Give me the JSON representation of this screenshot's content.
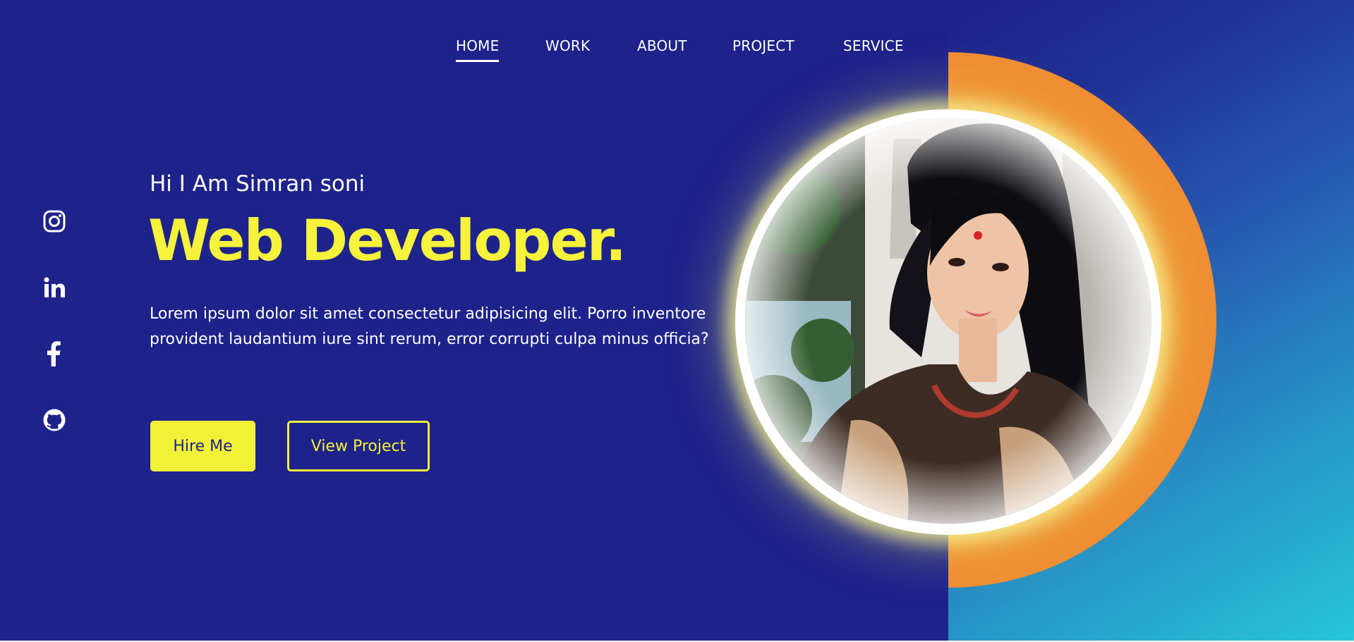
{
  "nav": {
    "items": [
      {
        "label": "HOME",
        "active": true
      },
      {
        "label": "WORK",
        "active": false
      },
      {
        "label": "ABOUT",
        "active": false
      },
      {
        "label": "PROJECT",
        "active": false
      },
      {
        "label": "SERVICE",
        "active": false
      }
    ]
  },
  "social": {
    "icons": [
      "instagram-icon",
      "linkedin-icon",
      "facebook-icon",
      "github-icon"
    ]
  },
  "hero": {
    "greeting": "Hi I Am Simran soni",
    "headline": "Web Developer.",
    "description": "Lorem ipsum dolor sit amet consectetur adipisicing elit. Porro inventore provident laudantium iure sint rerum, error corrupti culpa minus officia?",
    "hire_label": "Hire Me",
    "view_label": "View Project"
  },
  "colors": {
    "background": "#1e228b",
    "accent_yellow": "#f1f237",
    "accent_orange": "#f08c33",
    "gradient_end": "#27c6db"
  }
}
